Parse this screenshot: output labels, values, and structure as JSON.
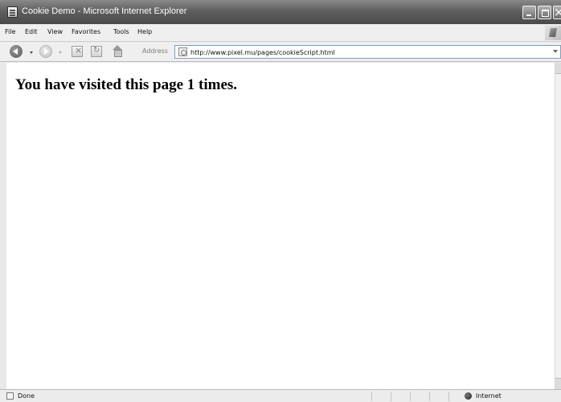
{
  "window": {
    "title": "Cookie Demo - Microsoft Internet Explorer"
  },
  "menu": {
    "items": [
      "File",
      "Edit",
      "View",
      "Favorites",
      "Tools",
      "Help"
    ]
  },
  "toolbar": {
    "address_label": "Address",
    "address_url": "http://www.pixel.mu/pages/cookieScript.html"
  },
  "page": {
    "message": "You have visited this page 1 times."
  },
  "status": {
    "text": "Done",
    "zone": "Internet"
  },
  "icons": {
    "app": "ie-page-icon",
    "back": "back-arrow-icon",
    "forward": "forward-arrow-icon",
    "stop": "stop-icon",
    "refresh": "refresh-icon",
    "home": "home-icon",
    "zone": "globe-icon"
  }
}
